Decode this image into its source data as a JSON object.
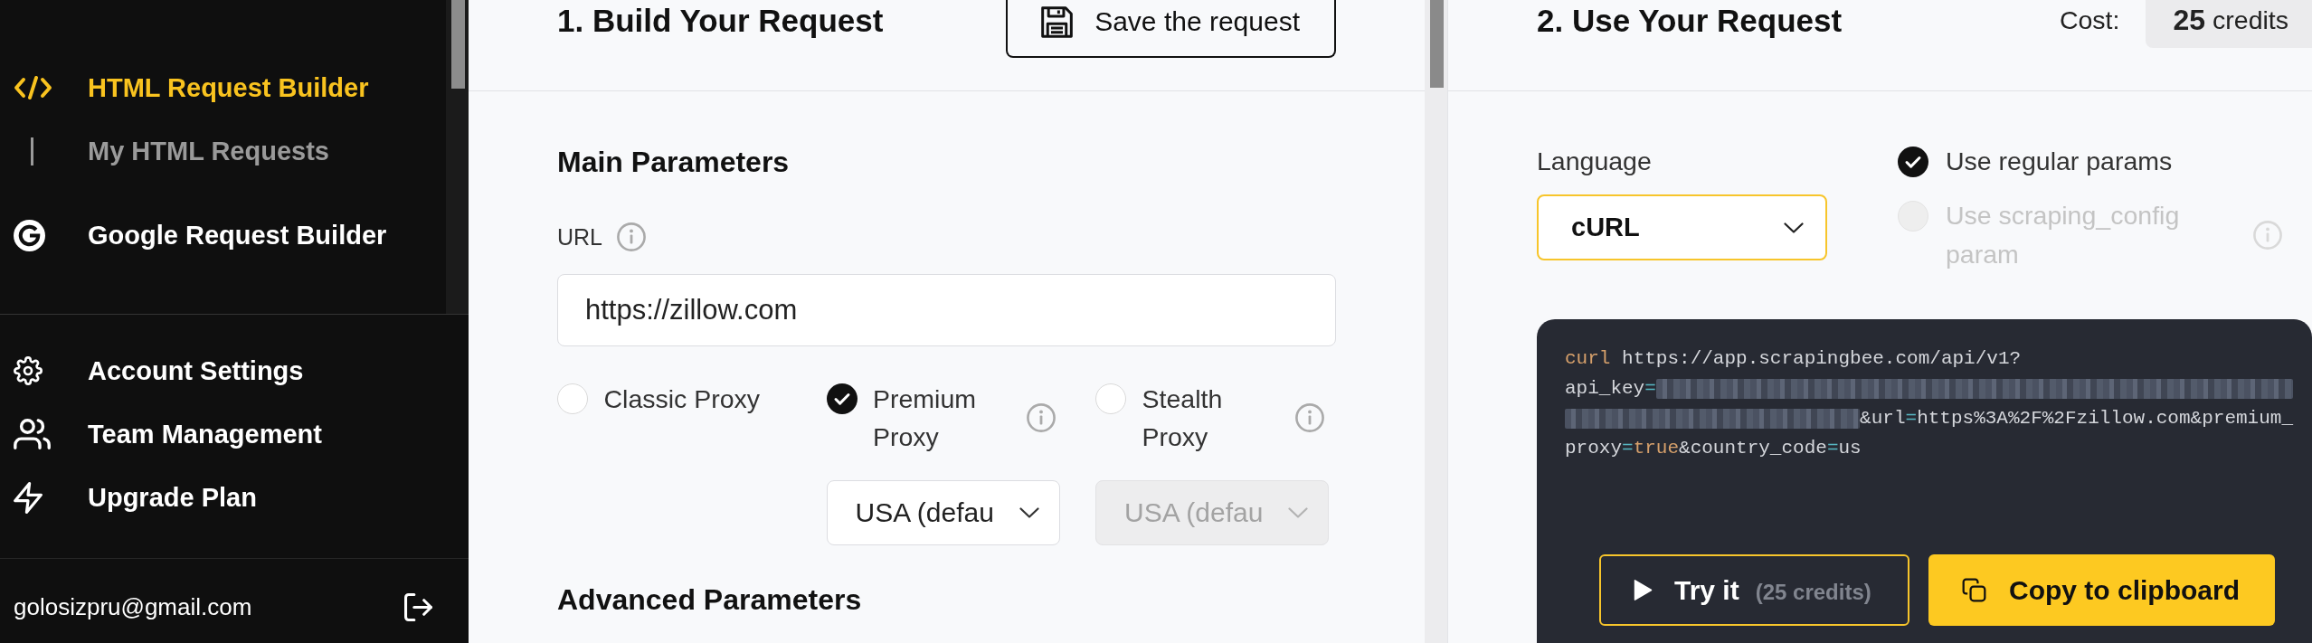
{
  "sidebar": {
    "nav": [
      {
        "label": "HTML Request Builder",
        "selected": true,
        "children": [
          {
            "label": "My HTML Requests",
            "selected": false
          }
        ]
      },
      {
        "label": "Google Request Builder",
        "selected": false
      }
    ],
    "account_links": [
      {
        "label": "Account Settings",
        "selected": false
      },
      {
        "label": "Team Management",
        "selected": false
      },
      {
        "label": "Upgrade Plan",
        "selected": false
      }
    ],
    "user_email": "golosizpru@gmail.com"
  },
  "builder": {
    "title": "1. Build Your Request",
    "save_button": "Save the request",
    "section_title": "Main Parameters",
    "url": {
      "label": "URL",
      "info": true,
      "value": "https://zillow.com"
    },
    "proxies": [
      {
        "label": "Classic Proxy",
        "selected": false
      },
      {
        "label": "Premium Proxy",
        "selected": true,
        "info": true,
        "country": {
          "value": "USA (defau",
          "disabled": false
        }
      },
      {
        "label": "Stealth Proxy",
        "selected": false,
        "info": true,
        "country": {
          "value": "USA (defau",
          "disabled": true
        }
      }
    ],
    "advanced_title": "Advanced Parameters"
  },
  "usage": {
    "title": "2. Use Your Request",
    "cost": {
      "label": "Cost:",
      "value": "**25** credits"
    },
    "language": {
      "label": "Language",
      "value": "cURL",
      "focused": true
    },
    "param_modes": [
      {
        "label": "Use regular params",
        "selected": true,
        "disabled": false
      },
      {
        "label": "Use scraping_config param",
        "selected": false,
        "disabled": true,
        "info": true
      }
    ],
    "code": {
      "lines": [
        [
          {
            "kind": "keyword",
            "text": "curl"
          },
          {
            "kind": "plain",
            "text": " https://app.scrapingbee.com/api/v1?"
          }
        ],
        [
          {
            "kind": "plain",
            "text": "api_key"
          },
          {
            "kind": "operator",
            "text": "="
          },
          {
            "kind": "redacted"
          }
        ],
        [
          {
            "kind": "redacted"
          },
          {
            "kind": "plain",
            "text": "&url"
          },
          {
            "kind": "operator",
            "text": "="
          },
          {
            "kind": "plain",
            "text": "https%3A%2F%2Fzillow.com&premium_"
          }
        ],
        [
          {
            "kind": "plain",
            "text": "proxy"
          },
          {
            "kind": "operator",
            "text": "="
          },
          {
            "kind": "keyword",
            "text": "true"
          },
          {
            "kind": "plain",
            "text": "&country_code"
          },
          {
            "kind": "operator",
            "text": "="
          },
          {
            "kind": "plain",
            "text": "us"
          }
        ]
      ]
    },
    "try_button": {
      "label": "Try it",
      "note": "(25 credits)"
    },
    "copy_button": "Copy to clipboard"
  }
}
